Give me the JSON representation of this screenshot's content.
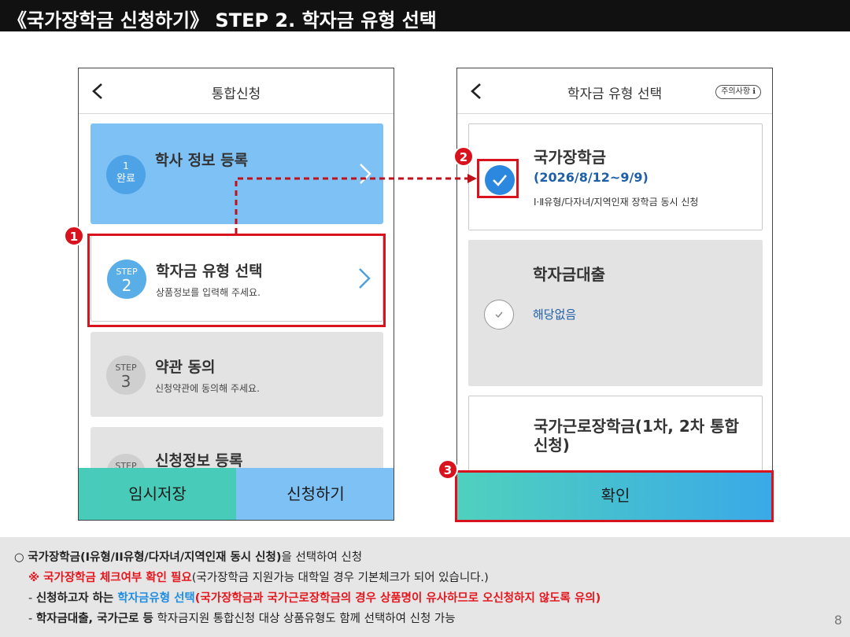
{
  "title": "《국가장학금 신청하기》 STEP 2. 학자금 유형 선택",
  "left_screen": {
    "header_title": "통합신청",
    "steps": [
      {
        "badge_top": "1",
        "badge_bottom": "완료",
        "title": "학사 정보 등록",
        "desc": ""
      },
      {
        "badge_top": "STEP",
        "badge_bottom": "2",
        "title": "학자금 유형 선택",
        "desc": "상품정보를 입력해 주세요."
      },
      {
        "badge_top": "STEP",
        "badge_bottom": "3",
        "title": "약관 동의",
        "desc": "신청약관에 동의해 주세요."
      },
      {
        "badge_top": "STEP",
        "badge_bottom": "",
        "title": "신청정보 등록",
        "desc": ""
      }
    ],
    "buttons": {
      "temp_save": "임시저장",
      "apply": "신청하기"
    }
  },
  "right_screen": {
    "header_title": "학자금 유형 선택",
    "notice_button": "주의사항 ℹ",
    "products": [
      {
        "name": "국가장학금",
        "period": "(2026/8/12~9/9)",
        "detail": "Ⅰ·Ⅱ유형/다자녀/지역인재 장학금 동시 신청",
        "checked": true
      },
      {
        "name": "학자금대출",
        "status": "해당없음",
        "checked": false
      },
      {
        "name": "국가근로장학금(1차, 2차 통합 신청)",
        "checked": false
      }
    ],
    "confirm_button": "확인"
  },
  "markers": [
    "1",
    "2",
    "3"
  ],
  "notes": {
    "line1_bold": "국가장학금(I유형/II유형/다자녀/지역인재 동시 신청)",
    "line1_rest": "을 선택하여 신청",
    "line2_red": "※ 국가장학금 체크여부 확인 필요",
    "line2_rest": "(국가장학금 지원가능 대학일 경우 기본체크가 되어 있습니다.)",
    "line3_prefix": "- ",
    "line3_bold": "신청하고자 하는 ",
    "line3_blue": "학자금유형 선택",
    "line3_red": "(국가장학금과 국가근로장학금의 경우 상품명이 유사하므로 오신청하지 않도록 유의)",
    "line4_prefix": "- ",
    "line4_bold": "학자금대출, 국가근로 등",
    "line4_rest": " 학자금지원 통합신청 대상 상품유형도 함께 선택하여 신청 가능"
  },
  "page_number": "8",
  "colors": {
    "highlight_red": "#d9131d",
    "card_blue": "#7ec1f5",
    "teal": "#48cbb8",
    "check_blue": "#2b88de"
  }
}
